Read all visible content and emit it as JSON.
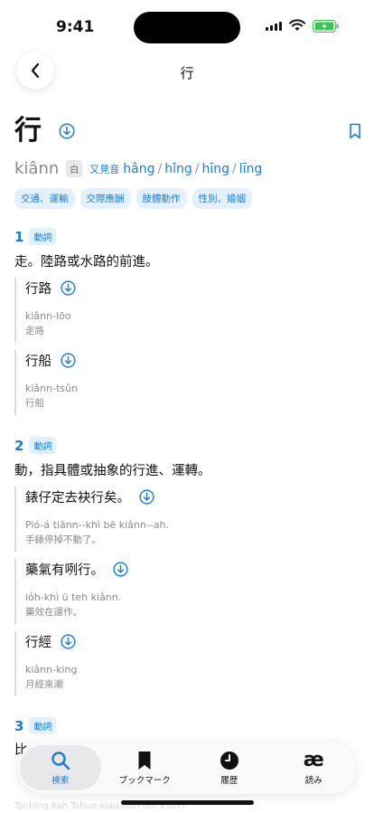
{
  "status": {
    "time": "9:41"
  },
  "nav": {
    "title": "行"
  },
  "entry": {
    "headword": "行",
    "romanization": "kiânn",
    "reading_type": "白",
    "alt_label": "又見音",
    "alt_readings": [
      "hâng",
      "hîng",
      "hīng",
      "līng"
    ],
    "tags": [
      "交通、運輸",
      "交際應酬",
      "肢體動作",
      "性別、婚姻"
    ]
  },
  "senses": [
    {
      "num": "1",
      "pos": "動詞",
      "definition": "走。陸路或水路的前進。",
      "examples": [
        {
          "hanji": "行路",
          "roman": "kiânn-lōo",
          "mandarin": "走路"
        },
        {
          "hanji": "行船",
          "roman": "kiânn-tsûn",
          "mandarin": "行船"
        }
      ]
    },
    {
      "num": "2",
      "pos": "動詞",
      "definition": "動，指具體或抽象的行進、運轉。",
      "examples": [
        {
          "hanji": "錶仔定去袂行矣。",
          "roman": "Pió-á tiānn--khì bē kiânn--ah.",
          "mandarin": "手錶停掉不動了。"
        },
        {
          "hanji": "藥氣有咧行。",
          "roman": "io̍h-khì ū teh kiânn.",
          "mandarin": "藥效在運作。"
        },
        {
          "hanji": "行經",
          "roman": "kiânn-king",
          "mandarin": "月經來潮"
        }
      ]
    },
    {
      "num": "3",
      "pos": "動詞",
      "definition_partial": "比",
      "faded_text": "Tsi-hīng kah Tshun-kiau-hun-teh kiânn"
    }
  ],
  "tabbar": {
    "tabs": [
      {
        "label": "検索",
        "icon": "search-icon",
        "active": true
      },
      {
        "label": "ブックマーク",
        "icon": "bookmark-icon",
        "active": false
      },
      {
        "label": "履歴",
        "icon": "clock-icon",
        "active": false
      },
      {
        "label": "読み",
        "icon": "ae-ligature-icon",
        "active": false,
        "glyph": "æ"
      }
    ]
  },
  "colors": {
    "accent": "#1a7fd4",
    "tag_bg": "#e3f1fd",
    "example_rule": "#c9e2f6"
  }
}
